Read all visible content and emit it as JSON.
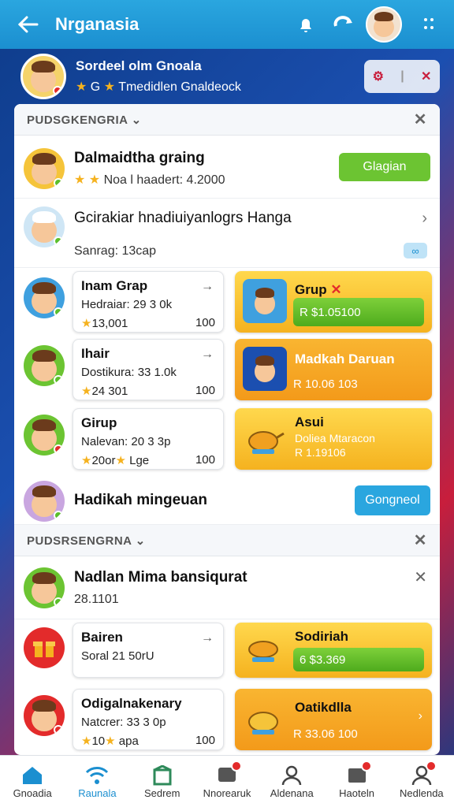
{
  "header": {
    "title": "Nrganasia"
  },
  "profile": {
    "name": "Sordeel olm Gnoala",
    "stars_label": "G",
    "subtitle": "Tmedidlen Gnaldeock"
  },
  "section1": {
    "title": "PUDSGKENGRIA",
    "rows": [
      {
        "name": "Dalmaidtha graing",
        "sub": "Noa l haadert: 4.2000",
        "button": "Glagian"
      },
      {
        "name": "Gcirakiar hnadiuiyanlogrs Hanga",
        "sub": "Sanrag: 13cap"
      }
    ],
    "cards": [
      {
        "title": "Inam Grap",
        "sub": "Hedraiar: 29 3 0k",
        "left": "13,001",
        "right": "100"
      },
      {
        "title": "Grup",
        "value": "R $1.05100"
      },
      {
        "title": "Ihair",
        "sub": "Dostikura: 33 1.0k",
        "left": "24 301",
        "right": "100"
      },
      {
        "title": "Madkah Daruan",
        "value": "R 10.06 103"
      },
      {
        "title": "Girup",
        "sub": "Nalevan: 20 3 3p",
        "left": "20or",
        "left2": "Lge",
        "right": "100"
      },
      {
        "title": "Asui",
        "sub": "Doliea Mtaracon",
        "value": "R 1.19106"
      }
    ],
    "last_row": {
      "name": "Hadikah mingeuan",
      "button": "Gongneol"
    }
  },
  "section2": {
    "title": "PUDSRSENGRNA",
    "rows": [
      {
        "name": "Nadlan Mima bansiqurat",
        "sub": "28.1101"
      }
    ],
    "cards": [
      {
        "title": "Bairen",
        "sub": "Soral 21 50rU"
      },
      {
        "title": "Sodiriah",
        "value": "6 $3.369"
      },
      {
        "title": "Odigalnakenary",
        "sub": "Natcrer: 33 3 0p",
        "left": "10",
        "left2": "apa",
        "right": "100"
      },
      {
        "title": "Oatikdlla",
        "value": "R 33.06 100"
      }
    ]
  },
  "nav": [
    {
      "label": "Gnoadia",
      "icon": "home-icon"
    },
    {
      "label": "Raunala",
      "icon": "wifi-icon"
    },
    {
      "label": "Sedrem",
      "icon": "store-icon"
    },
    {
      "label": "Nnorearuk",
      "icon": "chat-icon"
    },
    {
      "label": "Aldenana",
      "icon": "person-icon"
    },
    {
      "label": "Haoteln",
      "icon": "inbox-icon"
    },
    {
      "label": "Nedlenda",
      "icon": "group-icon"
    }
  ],
  "colors": {
    "accent": "#1b8fd0",
    "green": "#5bbf2b",
    "yellow": "#f5b21f",
    "red": "#e32b2b"
  }
}
